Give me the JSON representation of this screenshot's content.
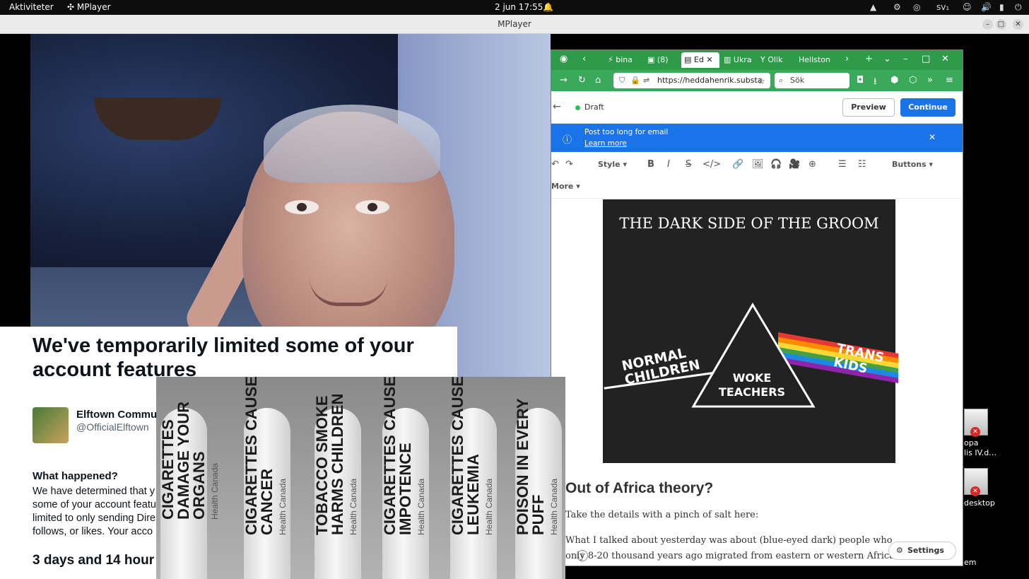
{
  "topbar": {
    "activities": "Aktiviteter",
    "app": "MPlayer",
    "clock": "2 jun 17:55",
    "keyboard": "sv₁"
  },
  "mplayer": {
    "title": "MPlayer"
  },
  "firefox": {
    "tabs": [
      "bina",
      "(8)",
      "Ed",
      "Ukra",
      "Olik",
      "Hellston"
    ],
    "url": "https://heddahenrik.substa",
    "search_placeholder": "Sök",
    "draft_label": "Draft",
    "preview_label": "Preview",
    "continue_label": "Continue",
    "banner_msg": "Post too long for email",
    "banner_link": "Learn more",
    "style_label": "Style",
    "buttons_label": "Buttons",
    "more_label": "More",
    "poster": {
      "title": "THE DARK SIDE OF THE GROOM",
      "left": "NORMAL\nCHILDREN",
      "mid": "WOKE\nTEACHERS",
      "right": "TRANS\nKIDS"
    },
    "heading": "Out of Africa theory?",
    "p1": "Take the details with a pinch of salt here:",
    "p2": "What I talked about yesterday was about (blue-eyed dark) people who only 8-20 thousand years ago migrated from eastern or western Africa along the coasts.",
    "settings_label": "Settings",
    "colors": {
      "tab_bg": "#2e9a4a",
      "accent": "#1a73e8"
    }
  },
  "twitter": {
    "title": "We've temporarily limited some of your account features",
    "name": "Elftown Commu",
    "handle": "@OfficialElftown",
    "what_heading": "What happened?",
    "body_lines": [
      "We have determined that y",
      "some of your account featu",
      "limited to only sending Dire",
      "follows, or likes. Your acco"
    ],
    "time_left": "3 days and 14 hour"
  },
  "cigarettes": [
    {
      "warning": "CIGARETTES DAMAGE YOUR ORGANS",
      "source": "Health Canada"
    },
    {
      "warning": "CIGARETTES CAUSE CANCER",
      "source": "Health Canada"
    },
    {
      "warning": "TOBACCO SMOKE HARMS CHILDREN",
      "source": "Health Canada"
    },
    {
      "warning": "CIGARETTES CAUSE IMPOTENCE",
      "source": "Health Canada"
    },
    {
      "warning": "CIGARETTES CAUSE LEUKEMIA",
      "source": "Health Canada"
    },
    {
      "warning": "POISON IN EVERY PUFF",
      "source": "Health Canada"
    }
  ],
  "desktop": {
    "icon1_label": "opa\nlis IV.d…",
    "icon2_label": "desktop",
    "icon3_label": "em"
  }
}
